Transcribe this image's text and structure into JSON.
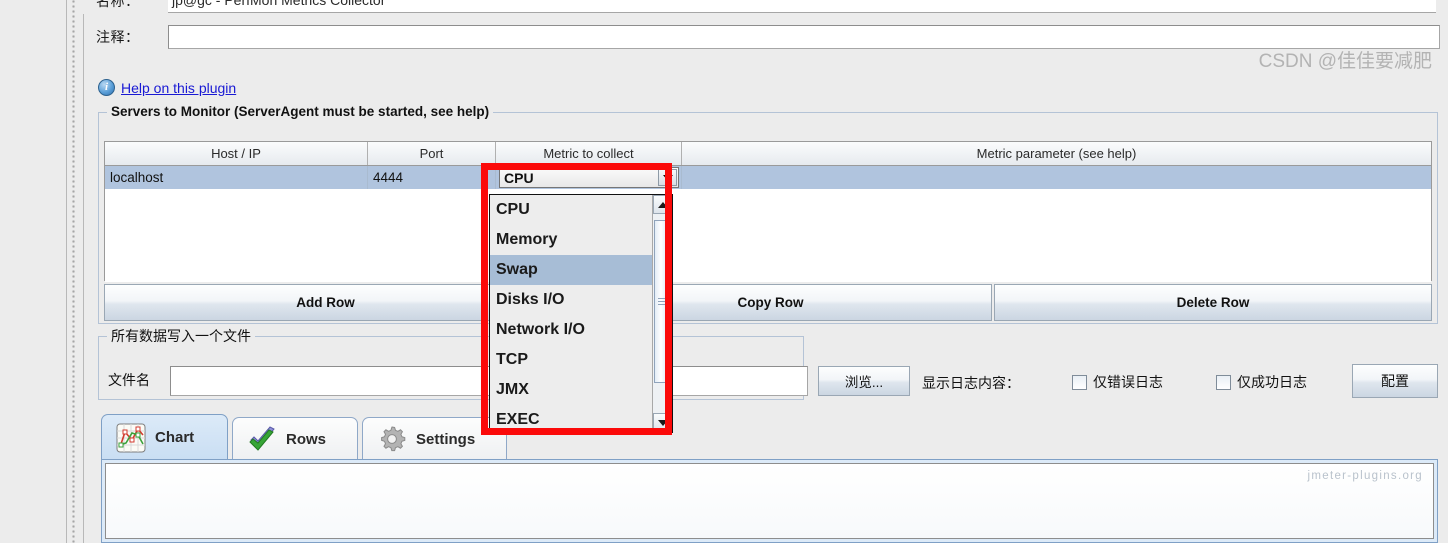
{
  "window": {
    "name_label": "名称：",
    "name_value": "jp@gc - PerfMon Metrics Collector",
    "comment_label": "注释：",
    "comment_value": "",
    "comment_placeholder": ""
  },
  "help": {
    "icon": "info-icon",
    "link_text": "Help on this plugin"
  },
  "servers_group": {
    "title": "Servers to Monitor (ServerAgent must be started, see help)",
    "table": {
      "columns": [
        "Host / IP",
        "Port",
        "Metric to collect",
        "Metric parameter (see help)"
      ],
      "rows": [
        {
          "host": "localhost",
          "port": "4444",
          "metric": "CPU",
          "parameter": "",
          "selected": true
        }
      ]
    },
    "buttons": {
      "add_row": "Add Row",
      "copy_row": "Copy Row",
      "delete_row": "Delete Row"
    }
  },
  "metric_dropdown": {
    "open": true,
    "selected_value": "CPU",
    "highlighted": "Swap",
    "options": [
      "CPU",
      "Memory",
      "Swap",
      "Disks I/O",
      "Network I/O",
      "TCP",
      "JMX",
      "EXEC"
    ],
    "scroll_up_icon": "triangle-up-icon",
    "scroll_down_icon": "triangle-down-icon"
  },
  "file_group": {
    "title": "所有数据写入一个文件",
    "filename_label": "文件名",
    "filename_value": "",
    "browse_button": "浏览...",
    "log_content_label": "显示日志内容：",
    "checkbox_errors_only": "仅错误日志",
    "checkbox_success_only": "仅成功日志",
    "errors_only_checked": false,
    "success_only_checked": false,
    "configure_button": "配置"
  },
  "tabs": [
    {
      "label": "Chart",
      "icon": "line-chart-icon",
      "active": true
    },
    {
      "label": "Rows",
      "icon": "green-check-icon",
      "active": false
    },
    {
      "label": "Settings",
      "icon": "gear-icon",
      "active": false
    }
  ],
  "watermarks": {
    "plugins": "jmeter-plugins.org",
    "csdn": "CSDN @佳佳要减肥"
  },
  "annotation": {
    "color": "#fb0a0a",
    "shape": "rectangle-highlight"
  },
  "colors": {
    "selection_blue": "#b0c4de",
    "link_blue": "#1919d4",
    "annotation_red": "#fb0a0a",
    "tab_active": "#dceaf8",
    "panel_bg": "#ececec"
  }
}
